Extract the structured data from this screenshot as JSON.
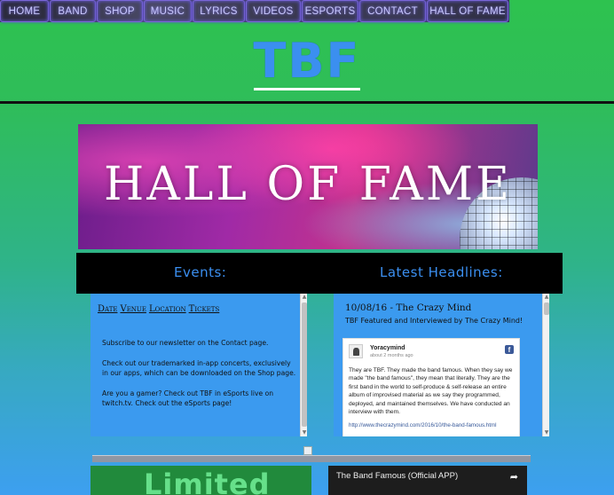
{
  "nav": {
    "items": [
      {
        "label": "HOME"
      },
      {
        "label": "BAND"
      },
      {
        "label": "SHOP"
      },
      {
        "label": "MUSIC"
      },
      {
        "label": "LYRICS"
      },
      {
        "label": "VIDEOS"
      },
      {
        "label": "ESPORTS"
      },
      {
        "label": "CONTACT"
      },
      {
        "label": "HALL OF FAME"
      }
    ]
  },
  "header": {
    "title": "TBF"
  },
  "banner": {
    "title": "HALL OF FAME"
  },
  "sections": {
    "events_heading": "Events:",
    "headlines_heading": "Latest Headlines:"
  },
  "events": {
    "columns": [
      "Date",
      "Venue",
      "Location",
      "Tickets"
    ],
    "paragraphs": [
      "Subscribe to our newsletter on the Contact page.",
      "Check out our trademarked in-app concerts, exclusively in our apps, which can be downloaded on the Shop page.",
      "Are you a gamer? Check out TBF in eSports live on twitch.tv. Check out the eSports page!"
    ]
  },
  "headlines": {
    "title": "10/08/16 - The Crazy Mind",
    "subtitle": "TBF Featured and Interviewed by The Crazy Mind!",
    "post": {
      "author": "Yoracymind",
      "time": "about 2 months ago",
      "body": "They are TBF. They made the band famous. When they say we made \"the band famous\", they mean that literally. They are the first band in the world to self-produce & self-release an entire album of improvised material as we say they programmed, deployed, and maintained themselves. We have conducted an interview with them.",
      "link": "http://www.thecrazymind.com/2016/10/the-band-famous.html"
    }
  },
  "tiles": {
    "promo_text": "Limited",
    "video_title": "The Band Famous (Official APP)"
  },
  "colors": {
    "accent_blue": "#3b8ff0",
    "nav_glow": "#7a66d8",
    "panel_blue": "#3b9aef"
  }
}
